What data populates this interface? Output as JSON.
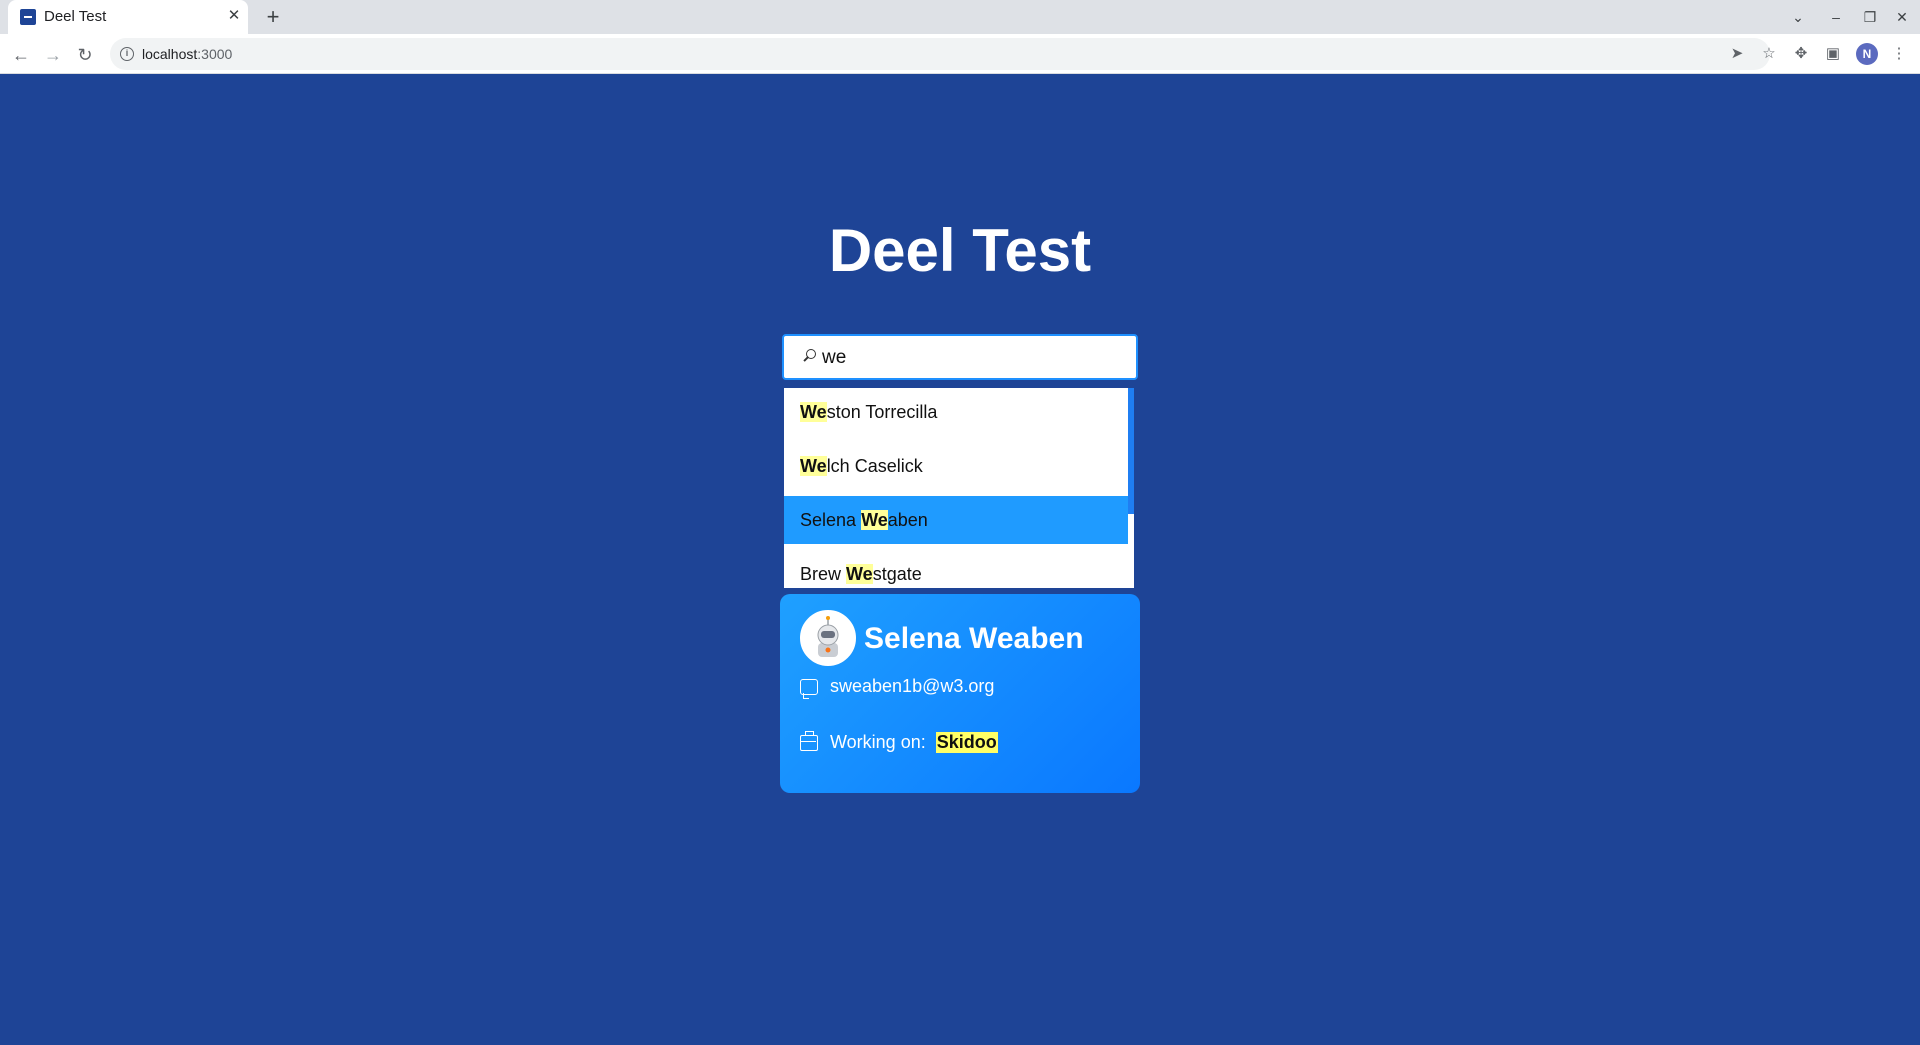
{
  "browser": {
    "tab_title": "Deel Test",
    "url_host": "localhost",
    "url_port": ":3000",
    "profile_initial": "N"
  },
  "page": {
    "title": "Deel Test"
  },
  "search": {
    "value": "we"
  },
  "results": [
    {
      "pre": "",
      "match": "We",
      "post": "ston Torrecilla",
      "selected": false
    },
    {
      "pre": "",
      "match": "We",
      "post": "lch Caselick",
      "selected": false
    },
    {
      "pre": "Selena ",
      "match": "We",
      "post": "aben",
      "selected": true
    },
    {
      "pre": "Brew ",
      "match": "We",
      "post": "stgate",
      "selected": false
    }
  ],
  "card": {
    "name": "Selena Weaben",
    "email": "sweaben1b@w3.org",
    "working_label": "Working on:",
    "project": "Skidoo"
  },
  "colors": {
    "background": "#1e4496",
    "accent": "#1f9bff",
    "highlight": "#ffff99"
  }
}
